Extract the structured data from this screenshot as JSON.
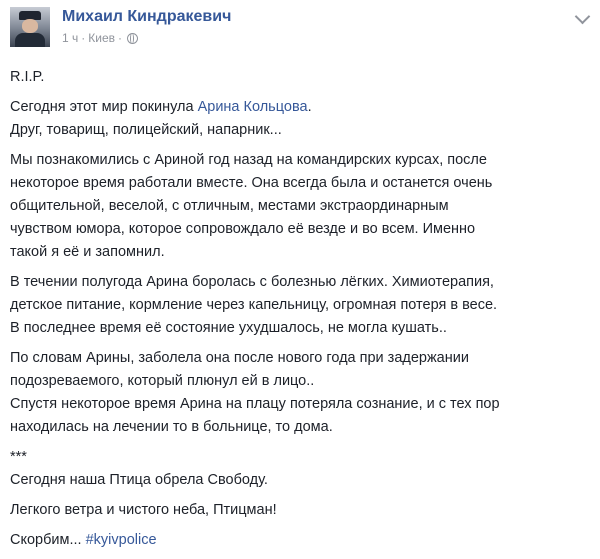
{
  "post": {
    "author": "Михаил Киндракевич",
    "time": "1 ч",
    "separator": "·",
    "location": "Киев",
    "privacy_icon": "globe-icon",
    "menu_icon": "chevron-down-icon",
    "paragraphs": [
      {
        "lines": [
          "R.I.P."
        ]
      },
      {
        "lines": [
          "Сегодня этот мир покинула ",
          "Друг, товарищ, полицейский, напарник..."
        ],
        "mention": "Арина Кольцова",
        "mention_suffix": "."
      },
      {
        "lines": [
          "Мы познакомились с Ариной год назад на командирских курсах, после",
          "некоторое время работали вместе. Она всегда была и останется очень",
          "общительной, веселой, с отличным, местами экстраординарным",
          "чувством юмора, которое сопровождало её везде и во всем. Именно",
          "такой я её и запомнил."
        ]
      },
      {
        "lines": [
          "В течении полугода Арина боролась с болезнью лёгких. Химиотерапия,",
          "детское питание, кормление через капельницу, огромная потеря в весе.",
          "В последнее время её состояние ухудшалось, не могла кушать.."
        ]
      },
      {
        "lines": [
          "По словам Арины, заболела она после нового года при задержании",
          "подозреваемого, который плюнул ей в лицо..",
          "Спустя некоторое время Арина на плацу потеряла сознание, и с тех пор",
          "находилась на лечении то в больнице, то дома."
        ]
      },
      {
        "lines": [
          "***",
          "Сегодня наша Птица обрела Свободу."
        ]
      },
      {
        "lines": [
          "Легкого ветра и чистого неба, Птицман!"
        ]
      },
      {
        "lines": [
          "Скорбим... "
        ],
        "hashtag": "#kyivpolice"
      }
    ]
  }
}
